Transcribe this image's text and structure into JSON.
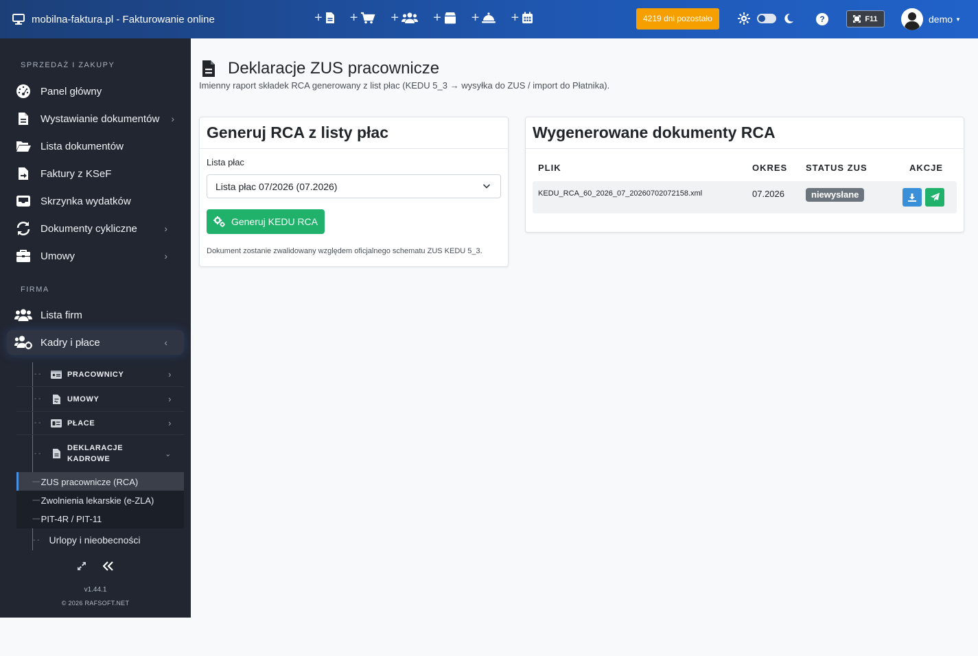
{
  "header": {
    "brand": "mobilna-faktura.pl - Fakturowanie online",
    "days_left": "4219 dni pozostało",
    "fullscreen_key": "F11",
    "user": "demo"
  },
  "sidebar": {
    "section_sales": "SPRZEDAŻ I ZAKUPY",
    "section_company": "FIRMA",
    "items": [
      {
        "label": "Panel główny"
      },
      {
        "label": "Wystawianie dokumentów"
      },
      {
        "label": "Lista dokumentów"
      },
      {
        "label": "Faktury z KSeF"
      },
      {
        "label": "Skrzynka wydatków"
      },
      {
        "label": "Dokumenty cykliczne"
      },
      {
        "label": "Umowy"
      },
      {
        "label": "Lista firm"
      },
      {
        "label": "Kadry i płace"
      }
    ],
    "sub": [
      {
        "label": "PRACOWNICY"
      },
      {
        "label": "UMOWY"
      },
      {
        "label": "PŁACE"
      },
      {
        "label1": "DEKLARACJE",
        "label2": "KADROWE"
      }
    ],
    "leaves": [
      {
        "label": "ZUS pracownicze (RCA)"
      },
      {
        "label": "Zwolnienia lekarskie (e-ZLA)"
      },
      {
        "label": "PIT-4R / PIT-11"
      }
    ],
    "urlopy": "Urlopy i nieobecności",
    "version": "v1.44.1",
    "copyright": "© 2026 RAFSOFT.NET"
  },
  "page": {
    "title": "Deklaracje ZUS pracownicze",
    "subtitle": "Imienny raport składek RCA generowany z list płac (KEDU 5_3 → wysyłka do ZUS / import do Płatnika)."
  },
  "generate_card": {
    "title": "Generuj RCA z listy płac",
    "label": "Lista płac",
    "selected": "Lista płac 07/2026 (07.2026)",
    "button": "Generuj KEDU RCA",
    "note": "Dokument zostanie zwalidowany względem oficjalnego schematu ZUS KEDU 5_3."
  },
  "docs_card": {
    "title": "Wygenerowane dokumenty RCA",
    "columns": [
      "PLIK",
      "OKRES",
      "STATUS ZUS",
      "AKCJE"
    ],
    "rows": [
      {
        "file": "KEDU_RCA_60_2026_07_20260702072158.xml",
        "period": "07.2026",
        "status": "niewysłane"
      }
    ]
  },
  "colors": {
    "accent": "#1f58b4",
    "sidebar": "#212631",
    "badge_days": "#f59f00",
    "success": "#20b26b",
    "info": "#3a8fd9"
  }
}
